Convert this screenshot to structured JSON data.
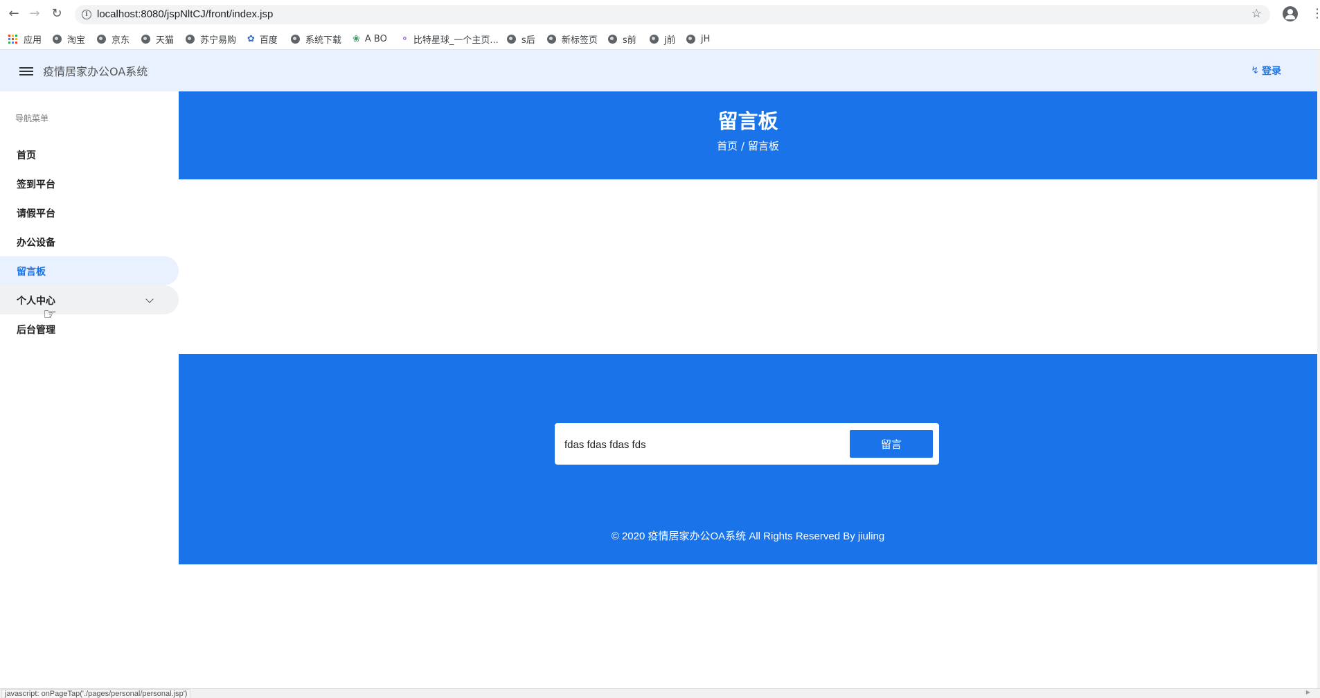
{
  "browser": {
    "url": "localhost:8080/jspNltCJ/front/index.jsp",
    "bookmarks": [
      {
        "label": "应用",
        "icon": "apps-grid-icon"
      },
      {
        "label": "淘宝",
        "icon": "globe-icon"
      },
      {
        "label": "京东",
        "icon": "globe-icon"
      },
      {
        "label": "天猫",
        "icon": "globe-icon"
      },
      {
        "label": "苏宁易购",
        "icon": "globe-icon"
      },
      {
        "label": "百度",
        "icon": "baidu-paw-icon"
      },
      {
        "label": "系统下载",
        "icon": "globe-icon"
      },
      {
        "label": "A BO",
        "icon": "leaf-icon"
      },
      {
        "label": "比特星球_一个主页...",
        "icon": "planet-icon"
      },
      {
        "label": "s后",
        "icon": "globe-icon"
      },
      {
        "label": "新标签页",
        "icon": "globe-icon"
      },
      {
        "label": "s前",
        "icon": "globe-icon"
      },
      {
        "label": "j前",
        "icon": "globe-icon"
      },
      {
        "label": "jH",
        "icon": "globe-icon"
      }
    ]
  },
  "header": {
    "title": "疫情居家办公OA系统",
    "login_label": "登录"
  },
  "sidebar": {
    "heading": "导航菜单",
    "items": [
      {
        "label": "首页",
        "state": "normal"
      },
      {
        "label": "签到平台",
        "state": "normal"
      },
      {
        "label": "请假平台",
        "state": "normal"
      },
      {
        "label": "办公设备",
        "state": "normal"
      },
      {
        "label": "留言板",
        "state": "active"
      },
      {
        "label": "个人中心",
        "state": "hover",
        "has_submenu": true
      },
      {
        "label": "后台管理",
        "state": "normal"
      }
    ]
  },
  "hero": {
    "title": "留言板",
    "breadcrumb": [
      "首页",
      "留言板"
    ],
    "separator": "/"
  },
  "message_form": {
    "input_value": "fdas fdas fdas fds",
    "submit_label": "留言"
  },
  "footer": {
    "copyright": "© 2020 疫情居家办公OA系统 All Rights Reserved By jiuling"
  },
  "status_bar": {
    "text": "javascript: onPageTap('./pages/personal/personal.jsp')"
  },
  "colors": {
    "primary": "#1a73e8",
    "header_bg": "#e8f1fd",
    "hover_bg": "#f0f1f3"
  }
}
